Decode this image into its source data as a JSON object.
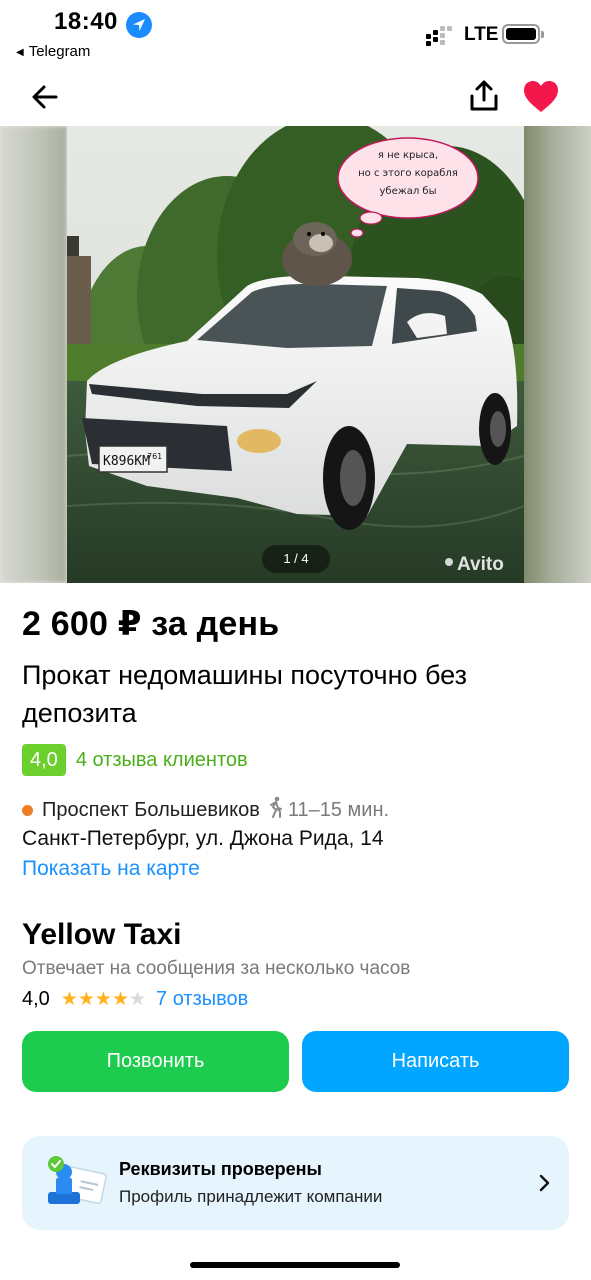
{
  "status_bar": {
    "time": "18:40",
    "back_app": "Telegram",
    "network": "LTE"
  },
  "nav": {
    "back_icon": "arrow-left-icon",
    "share_icon": "share-icon",
    "favorite_icon": "heart-icon",
    "favorite_color": "#f3174b"
  },
  "gallery": {
    "pager": "1 / 4",
    "watermark": "Avito",
    "thought_bubble": [
      "я не крыса,",
      "но с этого корабля",
      "убежал бы"
    ],
    "license_plate": "К896КМ",
    "plate_region": "761"
  },
  "listing": {
    "price": "2 600 ₽ за день",
    "title": "Прокат недомашины посуточно без депозита",
    "rating": "4,0",
    "reviews_link": "4 отзыва клиентов",
    "metro": "Проспект Большевиков",
    "metro_distance": "11–15 мин.",
    "address": "Санкт-Петербург, ул. Джона Рида, 14",
    "map_link": "Показать на карте"
  },
  "seller": {
    "name": "Yellow Taxi",
    "response": "Отвечает на сообщения за несколько часов",
    "rating": "4,0",
    "stars_filled": 4,
    "stars_total": 5,
    "reviews": "7 отзывов"
  },
  "actions": {
    "call": "Позвонить",
    "write": "Написать",
    "call_color": "#1dcc4f",
    "write_color": "#00a6ff"
  },
  "verification": {
    "icon": "verified-stamp-icon",
    "title": "Реквизиты проверены",
    "subtitle": "Профиль принадлежит компании"
  }
}
